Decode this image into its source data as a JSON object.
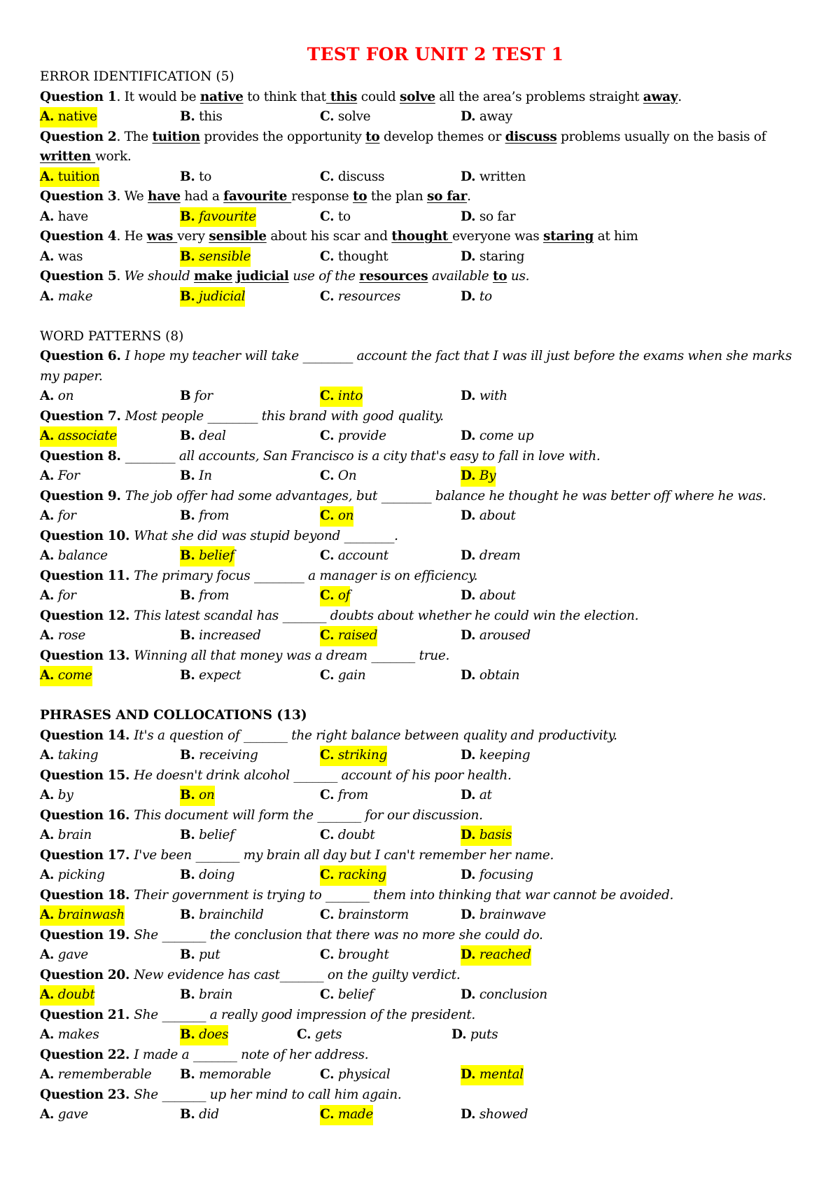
{
  "title": "TEST FOR UNIT 2 TEST 1",
  "highlight_color": "#ffff00",
  "title_color": "#ff0000",
  "sections": [
    {
      "heading": "ERROR IDENTIFICATION (5)",
      "heading_bold": false,
      "questions": [
        {
          "label": "Question 1",
          "parts": [
            {
              "t": ". It would be "
            },
            {
              "t": "native",
              "u": true
            },
            {
              "t": " to think that"
            },
            {
              "t": " this",
              "u": true
            },
            {
              "t": " could "
            },
            {
              "t": "solve",
              "u": true
            },
            {
              "t": " all the area’s problems straight "
            },
            {
              "t": "away",
              "u": true
            },
            {
              "t": "."
            }
          ],
          "italic": false,
          "options": [
            {
              "letter": "A.",
              "text": "native",
              "correct": true
            },
            {
              "letter": "B.",
              "text": "this",
              "correct": false
            },
            {
              "letter": "C.",
              "text": "solve",
              "correct": false
            },
            {
              "letter": "D.",
              "text": "away",
              "correct": false
            }
          ],
          "options_italic": false
        },
        {
          "label": "Question 2",
          "parts": [
            {
              "t": ". The "
            },
            {
              "t": "tuition",
              "u": true
            },
            {
              "t": " provides the opportunity "
            },
            {
              "t": "to",
              "u": true
            },
            {
              "t": " develop themes or "
            },
            {
              "t": "discuss",
              "u": true
            },
            {
              "t": " problems usually on the basis of "
            },
            {
              "t": "written ",
              "u": true
            },
            {
              "t": "work."
            }
          ],
          "italic": false,
          "options": [
            {
              "letter": "A.",
              "text": "tuition",
              "correct": true
            },
            {
              "letter": "B.",
              "text": "to",
              "correct": false
            },
            {
              "letter": "C.",
              "text": "discuss",
              "correct": false
            },
            {
              "letter": "D.",
              "text": "written",
              "correct": false
            }
          ],
          "options_italic": false
        },
        {
          "label": "Question 3",
          "parts": [
            {
              "t": ". We "
            },
            {
              "t": "have",
              "u": true
            },
            {
              "t": " had a "
            },
            {
              "t": "favourite ",
              "u": true
            },
            {
              "t": " response "
            },
            {
              "t": "to",
              "u": true
            },
            {
              "t": " the plan "
            },
            {
              "t": "so far",
              "u": true
            },
            {
              "t": "."
            }
          ],
          "italic": false,
          "options": [
            {
              "letter": "A.",
              "text": "have",
              "correct": false
            },
            {
              "letter": "B.",
              "text": "favourite",
              "correct": true,
              "italic": true
            },
            {
              "letter": "C.",
              "text": "to",
              "correct": false
            },
            {
              "letter": "D.",
              "text": "so far",
              "correct": false
            }
          ],
          "options_italic": false
        },
        {
          "label": "Question 4",
          "parts": [
            {
              "t": ". He "
            },
            {
              "t": "was ",
              "u": true
            },
            {
              "t": "very "
            },
            {
              "t": "sensible",
              "u": true
            },
            {
              "t": " about his scar and "
            },
            {
              "t": "thought ",
              "u": true
            },
            {
              "t": "everyone was "
            },
            {
              "t": "staring",
              "u": true
            },
            {
              "t": " at him"
            }
          ],
          "italic": false,
          "options": [
            {
              "letter": "A.",
              "text": "was",
              "correct": false
            },
            {
              "letter": "B.",
              "text": "sensible",
              "correct": true,
              "italic": true
            },
            {
              "letter": "C.",
              "text": "thought",
              "correct": false
            },
            {
              "letter": "D.",
              "text": "staring",
              "correct": false
            }
          ],
          "options_italic": false
        },
        {
          "label": "Question 5",
          "parts": [
            {
              "t": ". "
            },
            {
              "t": "We should ",
              "i": true
            },
            {
              "t": "make",
              "u": true
            },
            {
              "t": " "
            },
            {
              "t": "judicial",
              "u": true
            },
            {
              "t": " use of the ",
              "i": true
            },
            {
              "t": "resources",
              "u": true
            },
            {
              "t": " available ",
              "i": true
            },
            {
              "t": "to",
              "u": true
            },
            {
              "t": " us.",
              "i": true
            }
          ],
          "italic": false,
          "options": [
            {
              "letter": "A.",
              "text": "make",
              "correct": false
            },
            {
              "letter": "B.",
              "text": "judicial",
              "correct": true
            },
            {
              "letter": "C.",
              "text": "resources",
              "correct": false
            },
            {
              "letter": "D.",
              "text": "to",
              "correct": false
            }
          ],
          "options_italic": true
        }
      ]
    },
    {
      "heading": "WORD PATTERNS (8)",
      "heading_bold": false,
      "questions": [
        {
          "label": "Question 6",
          "stem": "I hope my teacher will take ________ account the fact that I was ill just before the exams when she marks my paper.",
          "options": [
            {
              "letter": "A.",
              "text": "on"
            },
            {
              "letter": "B",
              "text": "for"
            },
            {
              "letter": "C.",
              "text": "into",
              "correct": true
            },
            {
              "letter": "D.",
              "text": "with"
            }
          ]
        },
        {
          "label": "Question 7",
          "stem": "Most people ________ this brand with good quality.",
          "options": [
            {
              "letter": "A.",
              "text": "associate",
              "correct": true
            },
            {
              "letter": "B.",
              "text": "deal"
            },
            {
              "letter": "C.",
              "text": "provide"
            },
            {
              "letter": "D.",
              "text": "come up"
            }
          ]
        },
        {
          "label": "Question 8",
          "stem": "________ all accounts, San Francisco is a city that's easy to fall in love with.",
          "options": [
            {
              "letter": "A.",
              "text": "For"
            },
            {
              "letter": "B.",
              "text": "In"
            },
            {
              "letter": "C.",
              "text": "On"
            },
            {
              "letter": "D.",
              "text": "By",
              "correct": true
            }
          ]
        },
        {
          "label": "Question 9",
          "stem": "The job offer had some advantages, but ________ balance he thought he was better off where he was.",
          "options": [
            {
              "letter": "A.",
              "text": "for"
            },
            {
              "letter": "B.",
              "text": "from"
            },
            {
              "letter": "C.",
              "text": "on",
              "correct": true
            },
            {
              "letter": "D.",
              "text": "about"
            }
          ]
        },
        {
          "label": "Question 10",
          "stem": "What she did was stupid beyond ________.",
          "options": [
            {
              "letter": "A.",
              "text": "balance"
            },
            {
              "letter": "B.",
              "text": "belief",
              "correct": true
            },
            {
              "letter": "C.",
              "text": "account"
            },
            {
              "letter": "D.",
              "text": "dream"
            }
          ]
        },
        {
          "label": "Question 11",
          "stem": "The primary focus ________ a manager is on efficiency.",
          "options": [
            {
              "letter": "A.",
              "text": "for"
            },
            {
              "letter": "B.",
              "text": "from"
            },
            {
              "letter": "C.",
              "text": "of",
              "correct": true
            },
            {
              "letter": "D.",
              "text": "about"
            }
          ]
        },
        {
          "label": "Question 12",
          "stem": "This latest scandal has _______ doubts about whether he could win the election.",
          "options": [
            {
              "letter": "A.",
              "text": "rose"
            },
            {
              "letter": "B.",
              "text": "increased"
            },
            {
              "letter": "C.",
              "text": "raised",
              "correct": true
            },
            {
              "letter": "D.",
              "text": "aroused"
            }
          ]
        },
        {
          "label": "Question 13",
          "stem": "Winning all that money was a dream _______ true.",
          "options": [
            {
              "letter": "A.",
              "text": "come",
              "correct": true
            },
            {
              "letter": "B.",
              "text": "expect"
            },
            {
              "letter": "C.",
              "text": "gain"
            },
            {
              "letter": "D.",
              "text": "obtain"
            }
          ]
        }
      ]
    },
    {
      "heading": "PHRASES AND COLLOCATIONS (13)",
      "heading_bold": true,
      "questions": [
        {
          "label": "Question 14",
          "stem": "It's a question of _______ the right balance between quality and productivity.",
          "options": [
            {
              "letter": "A.",
              "text": "taking"
            },
            {
              "letter": "B.",
              "text": "receiving"
            },
            {
              "letter": "C.",
              "text": "striking",
              "correct": true
            },
            {
              "letter": "D.",
              "text": "keeping"
            }
          ]
        },
        {
          "label": "Question 15",
          "stem": "He doesn't drink alcohol _______ account of his poor health.",
          "options": [
            {
              "letter": "A.",
              "text": "by"
            },
            {
              "letter": "B.",
              "text": "on",
              "correct": true
            },
            {
              "letter": "C.",
              "text": "from"
            },
            {
              "letter": "D.",
              "text": "at"
            }
          ]
        },
        {
          "label": "Question 16",
          "stem": " This document will form the _______ for our discussion.",
          "options": [
            {
              "letter": "A.",
              "text": "brain"
            },
            {
              "letter": "B.",
              "text": "belief"
            },
            {
              "letter": "C.",
              "text": "doubt"
            },
            {
              "letter": "D.",
              "text": "basis",
              "correct": true
            }
          ]
        },
        {
          "label": "Question 17",
          "stem": " I've been _______ my brain all day but I can't remember her name.",
          "options": [
            {
              "letter": "A.",
              "text": "picking"
            },
            {
              "letter": "B.",
              "text": "doing"
            },
            {
              "letter": "C.",
              "text": "racking",
              "correct": true
            },
            {
              "letter": "D.",
              "text": "focusing"
            }
          ]
        },
        {
          "label": "Question 18",
          "stem": "Their government is trying to _______ them into thinking that war cannot be avoided.",
          "options": [
            {
              "letter": "A.",
              "text": "brainwash",
              "correct": true
            },
            {
              "letter": "B.",
              "text": "brainchild"
            },
            {
              "letter": "C.",
              "text": "brainstorm"
            },
            {
              "letter": "D.",
              "text": "brainwave"
            }
          ]
        },
        {
          "label": "Question 19",
          "stem": "She _______ the conclusion that there was no more she could do.",
          "options": [
            {
              "letter": "A.",
              "text": "gave"
            },
            {
              "letter": "B.",
              "text": "put"
            },
            {
              "letter": "C.",
              "text": "brought"
            },
            {
              "letter": "D.",
              "text": "reached",
              "correct": true
            }
          ]
        },
        {
          "label": "Question 20",
          "stem": "New evidence has cast_______ on the guilty verdict.",
          "options": [
            {
              "letter": "A.",
              "text": "doubt",
              "correct": true
            },
            {
              "letter": "B.",
              "text": "brain"
            },
            {
              "letter": "C.",
              "text": "belief"
            },
            {
              "letter": "D.",
              "text": "conclusion"
            }
          ]
        },
        {
          "label": "Question 21",
          "stem": "She _______ a really good impression of the president.",
          "narrow": true,
          "options": [
            {
              "letter": "A.",
              "text": "makes"
            },
            {
              "letter": "B.",
              "text": "does",
              "correct": true
            },
            {
              "letter": "C.",
              "text": "gets"
            },
            {
              "letter": "D.",
              "text": "puts"
            }
          ]
        },
        {
          "label": "Question 22",
          "stem": "I made a _______ note of her address.",
          "options": [
            {
              "letter": "A.",
              "text": "rememberable"
            },
            {
              "letter": "B.",
              "text": "memorable"
            },
            {
              "letter": "C.",
              "text": "physical"
            },
            {
              "letter": "D.",
              "text": "mental",
              "correct": true
            }
          ]
        },
        {
          "label": "Question 23",
          "stem": "She _______ up her mind to call him again.",
          "options": [
            {
              "letter": "A.",
              "text": "gave"
            },
            {
              "letter": "B.",
              "text": "did"
            },
            {
              "letter": "C.",
              "text": "made",
              "correct": true
            },
            {
              "letter": "D.",
              "text": "showed"
            }
          ]
        }
      ]
    }
  ]
}
